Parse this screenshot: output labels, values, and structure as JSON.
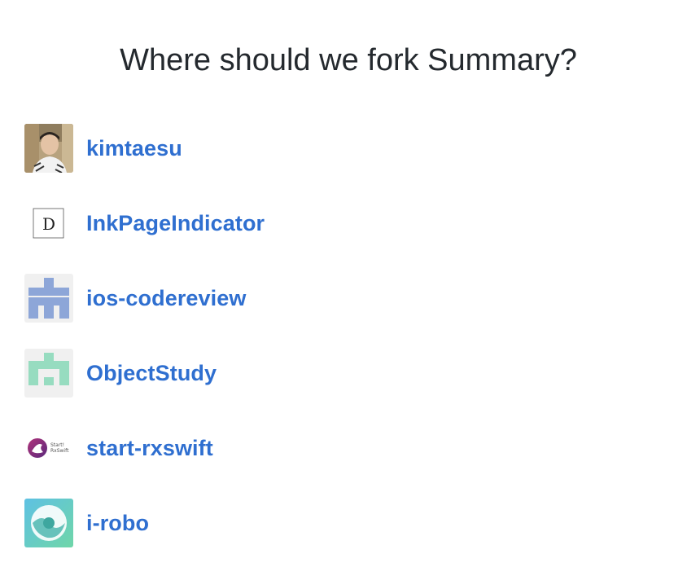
{
  "page": {
    "title": "Where should we fork Summary?"
  },
  "accounts": [
    {
      "name": "kimtaesu",
      "icon": "user-photo-avatar-icon"
    },
    {
      "name": "InkPageIndicator",
      "icon": "letter-d-avatar-icon",
      "avatar_text": "D"
    },
    {
      "name": "ios-codereview",
      "icon": "identicon-blue-avatar-icon",
      "color": "#8da6d8"
    },
    {
      "name": "ObjectStudy",
      "icon": "identicon-green-avatar-icon",
      "color": "#97dcc0"
    },
    {
      "name": "start-rxswift",
      "icon": "rxswift-logo-avatar-icon",
      "avatar_text_line1": "Start!",
      "avatar_text_line2": "RxSwift"
    },
    {
      "name": "i-robo",
      "icon": "i-robo-logo-avatar-icon"
    }
  ],
  "colors": {
    "link": "#2f6fd0",
    "title": "#24292e"
  }
}
